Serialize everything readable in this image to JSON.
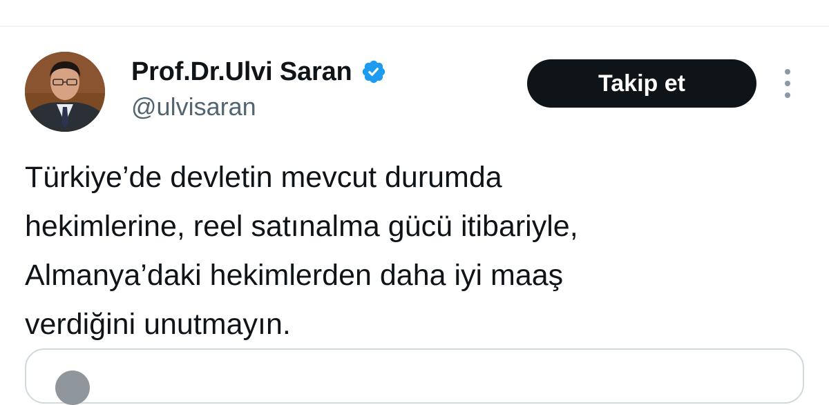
{
  "author": {
    "display_name": "Prof.Dr.Ulvi Saran",
    "handle": "@ulvisaran",
    "verified": true,
    "verified_icon": "verified-badge-icon",
    "verified_color": "#1d9bf0"
  },
  "actions": {
    "follow_label": "Takip et",
    "more_icon": "more-vertical-icon"
  },
  "tweet": {
    "lines": [
      "Türkiye’de devletin mevcut durumda",
      "hekimlerine, reel satınalma gücü itibariyle,",
      "Almanya’daki hekimlerden daha iyi maaş",
      "verdiğini unutmayın."
    ]
  },
  "colors": {
    "text": "#0f1419",
    "secondary_text": "#536471",
    "button_bg": "#0f1419",
    "button_text": "#ffffff",
    "border": "#cfd9de"
  }
}
